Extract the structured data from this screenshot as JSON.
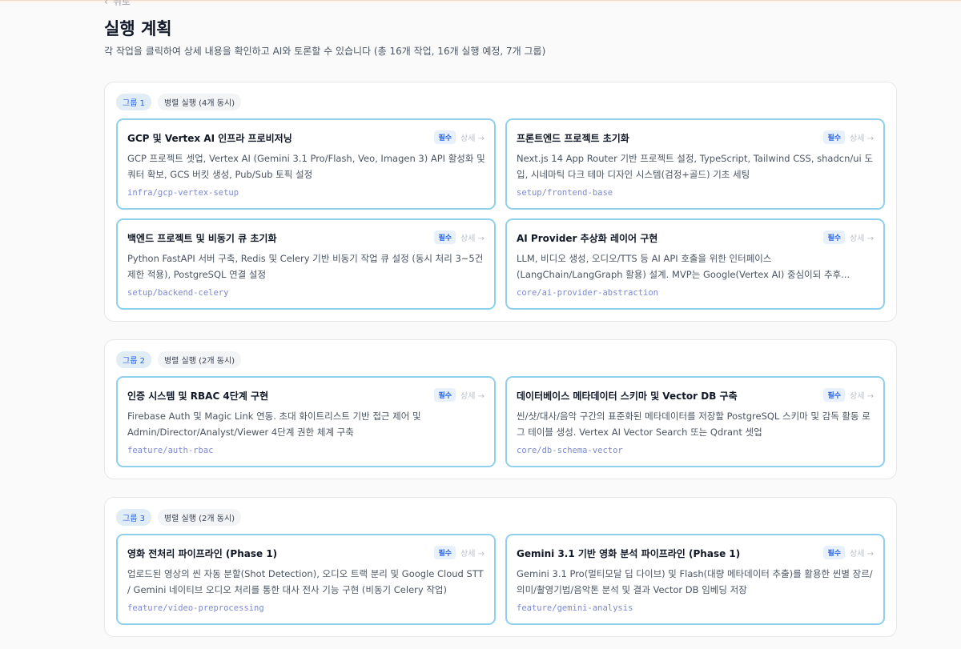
{
  "back": {
    "label": "뒤로"
  },
  "title": "실행 계획",
  "subtitle": "각 작업을 클릭하여 상세 내용을 확인하고 AI와 토론할 수 있습니다 (총 16개 작업, 16개 실행 예정, 7개 그룹)",
  "groups": [
    {
      "label": "그룹 1",
      "parallel": "병렬 실행 (4개 동시)",
      "tasks": [
        {
          "title": "GCP 및 Vertex AI 인프라 프로비저닝",
          "required": "필수",
          "detail": "상세 →",
          "description": "GCP 프로젝트 셋업, Vertex AI (Gemini 3.1 Pro/Flash, Veo, Imagen 3) API 활성화 및 쿼터 확보, GCS 버킷 생성, Pub/Sub 토픽 설정",
          "branch": "infra/gcp-vertex-setup"
        },
        {
          "title": "프론트엔드 프로젝트 초기화",
          "required": "필수",
          "detail": "상세 →",
          "description": "Next.js 14 App Router 기반 프로젝트 설정, TypeScript, Tailwind CSS, shadcn/ui 도입, 시네마틱 다크 테마 디자인 시스템(검정+골드) 기초 세팅",
          "branch": "setup/frontend-base"
        },
        {
          "title": "백엔드 프로젝트 및 비동기 큐 초기화",
          "required": "필수",
          "detail": "상세 →",
          "description": "Python FastAPI 서버 구축, Redis 및 Celery 기반 비동기 작업 큐 설정 (동시 처리 3~5건 제한 적용), PostgreSQL 연결 설정",
          "branch": "setup/backend-celery"
        },
        {
          "title": "AI Provider 추상화 레이어 구현",
          "required": "필수",
          "detail": "상세 →",
          "description": "LLM, 비디오 생성, 오디오/TTS 등 AI API 호출을 위한 인터페이스 (LangChain/LangGraph 활용) 설계. MVP는 Google(Vertex AI) 중심이되 추후...",
          "branch": "core/ai-provider-abstraction"
        }
      ]
    },
    {
      "label": "그룹 2",
      "parallel": "병렬 실행 (2개 동시)",
      "tasks": [
        {
          "title": "인증 시스템 및 RBAC 4단계 구현",
          "required": "필수",
          "detail": "상세 →",
          "description": "Firebase Auth 및 Magic Link 연동. 초대 화이트리스트 기반 접근 제어 및 Admin/Director/Analyst/Viewer 4단계 권한 체계 구축",
          "branch": "feature/auth-rbac"
        },
        {
          "title": "데이터베이스 메타데이터 스키마 및 Vector DB 구축",
          "required": "필수",
          "detail": "상세 →",
          "description": "씬/샷/대사/음악 구간의 표준화된 메타데이터를 저장할 PostgreSQL 스키마 및 감독 활동 로그 테이블 생성. Vertex AI Vector Search 또는 Qdrant 셋업",
          "branch": "core/db-schema-vector"
        }
      ]
    },
    {
      "label": "그룹 3",
      "parallel": "병렬 실행 (2개 동시)",
      "tasks": [
        {
          "title": "영화 전처리 파이프라인 (Phase 1)",
          "required": "필수",
          "detail": "상세 →",
          "description": "업로드된 영상의 씬 자동 분할(Shot Detection), 오디오 트랙 분리 및 Google Cloud STT / Gemini 네이티브 오디오 처리를 통한 대사 전사 기능 구현 (비동기 Celery 작업)",
          "branch": "feature/video-preprocessing"
        },
        {
          "title": "Gemini 3.1 기반 영화 분석 파이프라인 (Phase 1)",
          "required": "필수",
          "detail": "상세 →",
          "description": "Gemini 3.1 Pro(멀티모달 딥 다이브) 및 Flash(대량 메타데이터 추출)를 활용한 씬별 장르/의미/촬영기법/음악톤 분석 및 결과 Vector DB 임베딩 저장",
          "branch": "feature/gemini-analysis"
        }
      ]
    }
  ]
}
